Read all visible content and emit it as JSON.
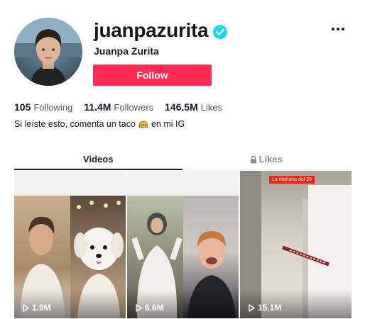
{
  "profile": {
    "username": "juanpazurita",
    "nickname": "Juanpa Zurita",
    "follow_label": "Follow",
    "bio": "Si leíste esto, comenta un taco",
    "bio_suffix": "en mi IG",
    "bio_emoji": "taco-icon"
  },
  "stats": [
    {
      "value": "105",
      "label": "Following"
    },
    {
      "value": "11.4M",
      "label": "Followers"
    },
    {
      "value": "146.5M",
      "label": "Likes"
    }
  ],
  "tabs": [
    {
      "label": "Videos",
      "active": true
    },
    {
      "label": "Likes",
      "active": false,
      "icon": "lock-icon"
    }
  ],
  "videos": [
    {
      "views": "1.9M",
      "icon": "play-icon"
    },
    {
      "views": "6.6M",
      "icon": "play-icon"
    },
    {
      "views": "15.1M",
      "icon": "play-icon",
      "badge": "La Mañana del 25"
    }
  ],
  "colors": {
    "accent": "#fe2c55",
    "verified": "#20d5ec",
    "text": "#161823",
    "muted": "#545660"
  }
}
